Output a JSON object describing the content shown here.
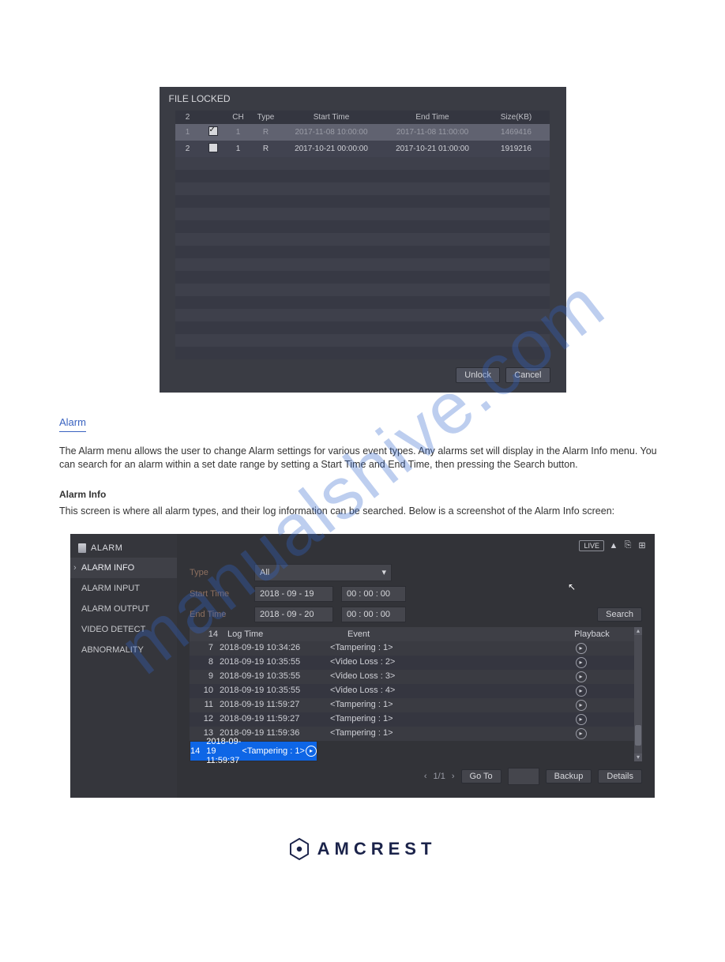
{
  "watermark": "manualshive.com",
  "brand": "AMCREST",
  "file_locked": {
    "title": "FILE LOCKED",
    "headers": [
      "2",
      "CH",
      "Type",
      "Start Time",
      "End Time",
      "Size(KB)"
    ],
    "rows": [
      {
        "idx": "1",
        "ch": "1",
        "type": "R",
        "start": "2017-11-08 10:00:00",
        "end": "2017-11-08 11:00:00",
        "size": "1469416"
      },
      {
        "idx": "2",
        "ch": "1",
        "type": "R",
        "start": "2017-10-21 00:00:00",
        "end": "2017-10-21 01:00:00",
        "size": "1919216"
      }
    ],
    "buttons": {
      "unlock": "Unlock",
      "cancel": "Cancel"
    }
  },
  "text": {
    "section_title": "Alarm",
    "p1": "The Alarm menu allows the user to change Alarm settings for various event types. Any alarms set will display in the Alarm Info menu. You can search for an alarm within a set date range by setting a Start Time and End Time, then pressing the Search button.",
    "sub1": "Alarm Info",
    "p2": "This screen is where all alarm types, and their log information can be searched. Below is a screenshot of the Alarm Info screen:"
  },
  "alarm": {
    "title": "ALARM",
    "top": {
      "live": "LIVE"
    },
    "side": [
      "ALARM INFO",
      "ALARM INPUT",
      "ALARM OUTPUT",
      "VIDEO DETECT",
      "ABNORMALITY"
    ],
    "form": {
      "type_label": "Type",
      "type_value": "All",
      "start_label": "Start Time",
      "start_date": "2018 - 09 - 19",
      "start_time": "00 : 00 : 00",
      "end_label": "End Time",
      "end_date": "2018 - 09 - 20",
      "end_time": "00 : 00 : 00",
      "search": "Search"
    },
    "grid": {
      "headers": [
        "14",
        "Log Time",
        "Event",
        "Playback"
      ],
      "rows": [
        {
          "idx": "7",
          "time": "2018-09-19 10:34:26",
          "event": "<Tampering : 1>",
          "sel": false
        },
        {
          "idx": "8",
          "time": "2018-09-19 10:35:55",
          "event": "<Video Loss : 2>",
          "sel": false
        },
        {
          "idx": "9",
          "time": "2018-09-19 10:35:55",
          "event": "<Video Loss : 3>",
          "sel": false
        },
        {
          "idx": "10",
          "time": "2018-09-19 10:35:55",
          "event": "<Video Loss : 4>",
          "sel": false
        },
        {
          "idx": "11",
          "time": "2018-09-19 11:59:27",
          "event": "<Tampering : 1>",
          "sel": false
        },
        {
          "idx": "12",
          "time": "2018-09-19 11:59:27",
          "event": "<Tampering : 1>",
          "sel": false
        },
        {
          "idx": "13",
          "time": "2018-09-19 11:59:36",
          "event": "<Tampering : 1>",
          "sel": false
        },
        {
          "idx": "14",
          "time": "2018-09-19 11:59:37",
          "event": "<Tampering : 1>",
          "sel": true
        }
      ]
    },
    "pager": {
      "page": "1/1",
      "goto": "Go To",
      "backup": "Backup",
      "details": "Details"
    }
  }
}
